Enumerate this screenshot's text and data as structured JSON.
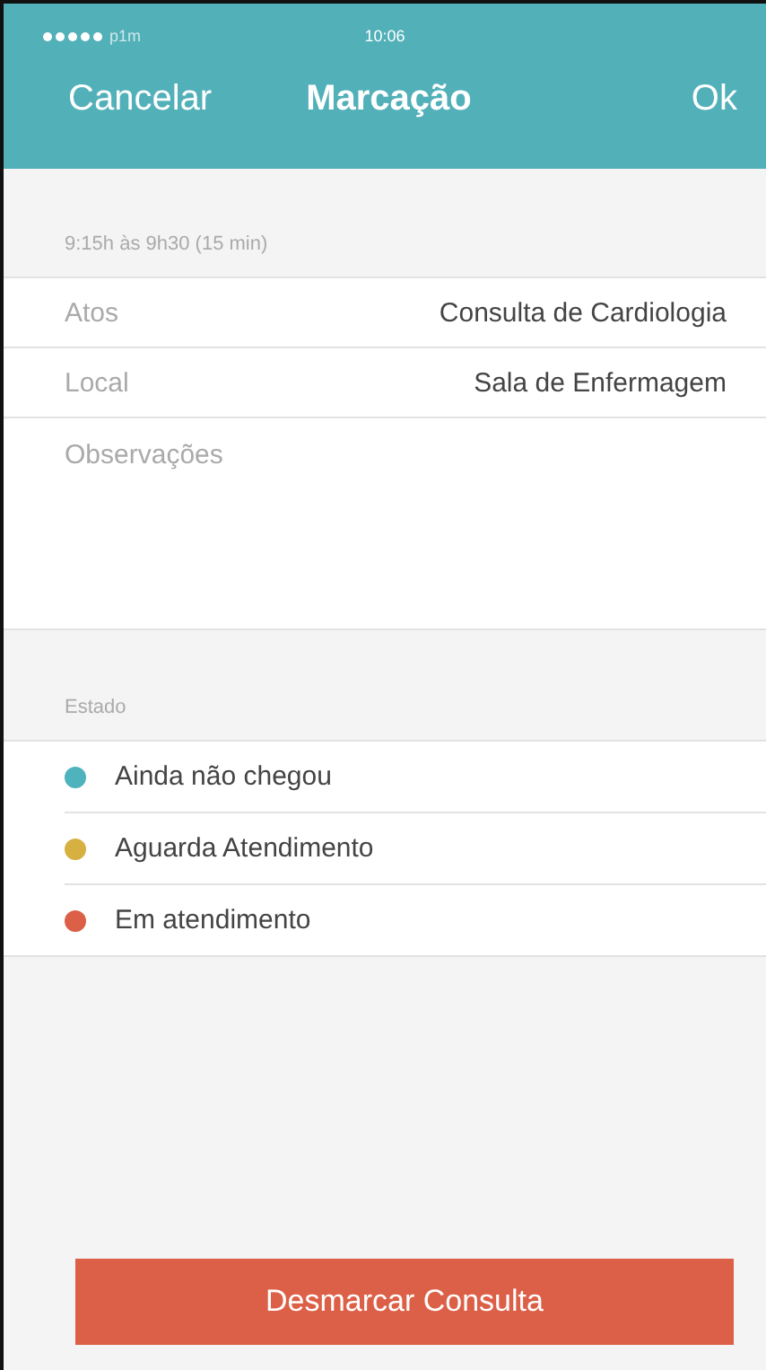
{
  "status_bar": {
    "carrier": "p1m",
    "time": "10:06"
  },
  "nav": {
    "cancel": "Cancelar",
    "title": "Marcação",
    "ok": "Ok"
  },
  "time_range": "9:15h às 9h30 (15 min)",
  "fields": [
    {
      "label": "Atos",
      "value": "Consulta de Cardiologia"
    },
    {
      "label": "Local",
      "value": "Sala de Enfermagem"
    }
  ],
  "notes": {
    "placeholder": "Observações"
  },
  "estado": {
    "heading": "Estado",
    "options": [
      {
        "label": "Ainda não chegou",
        "color": "#4eb3bc"
      },
      {
        "label": "Aguarda Atendimento",
        "color": "#d6b040"
      },
      {
        "label": "Em atendimento",
        "color": "#dc5f47"
      }
    ]
  },
  "action_button": "Desmarcar Consulta"
}
